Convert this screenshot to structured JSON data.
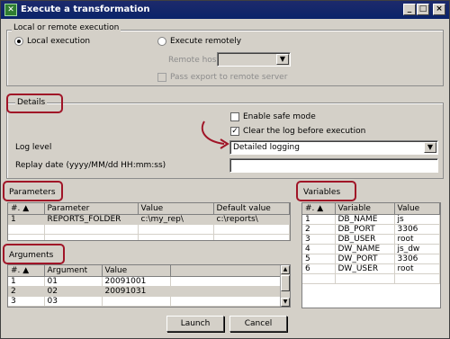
{
  "window": {
    "title": "Execute a transformation"
  },
  "local_remote": {
    "legend": "Local or remote execution",
    "local_label": "Local execution",
    "remote_label": "Execute remotely",
    "remote_host_label": "Remote host",
    "pass_export_label": "Pass export to remote server"
  },
  "details": {
    "legend": "Details",
    "safe_mode_label": "Enable safe mode",
    "clear_log_label": "Clear the log before execution",
    "log_level_label": "Log level",
    "log_level_value": "Detailed logging",
    "replay_label": "Replay date (yyyy/MM/dd HH:mm:ss)"
  },
  "parameters": {
    "title": "Parameters",
    "columns": [
      "#.",
      "Parameter",
      "Value",
      "Default value"
    ],
    "rows": [
      [
        "1",
        "REPORTS_FOLDER",
        "c:\\my_rep\\",
        "c:\\reports\\"
      ]
    ]
  },
  "variables": {
    "title": "Variables",
    "columns": [
      "#.",
      "Variable",
      "Value"
    ],
    "rows": [
      [
        "1",
        "DB_NAME",
        "js"
      ],
      [
        "2",
        "DB_PORT",
        "3306"
      ],
      [
        "3",
        "DB_USER",
        "root"
      ],
      [
        "4",
        "DW_NAME",
        "js_dw"
      ],
      [
        "5",
        "DW_PORT",
        "3306"
      ],
      [
        "6",
        "DW_USER",
        "root"
      ]
    ]
  },
  "arguments": {
    "title": "Arguments",
    "columns": [
      "#.",
      "Argument",
      "Value"
    ],
    "rows": [
      [
        "1",
        "01",
        "20091001"
      ],
      [
        "2",
        "02",
        "20091031"
      ],
      [
        "3",
        "03",
        ""
      ]
    ]
  },
  "buttons": {
    "launch": "Launch",
    "cancel": "Cancel"
  },
  "colors": {
    "highlight": "#a01427",
    "titlebar": "#0a246a"
  }
}
